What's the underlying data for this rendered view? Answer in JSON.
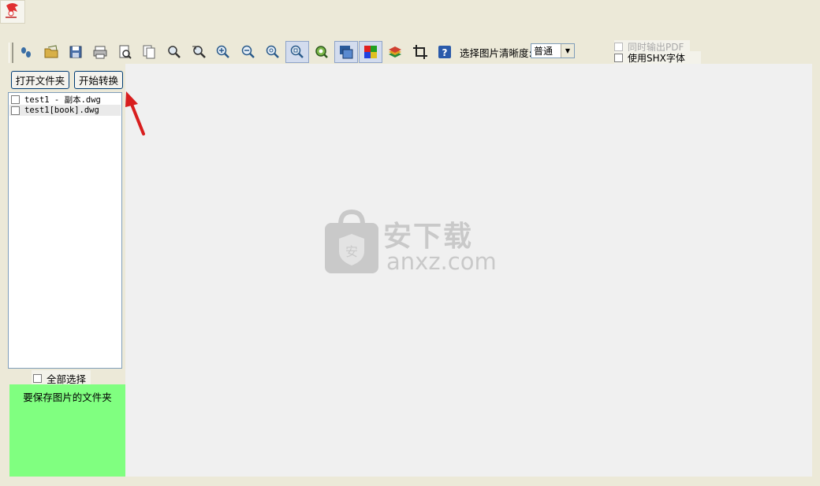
{
  "toolbar": {
    "buttons": [
      {
        "name": "footprints-icon"
      },
      {
        "name": "open-folder-icon"
      },
      {
        "name": "save-icon"
      },
      {
        "name": "print-icon"
      },
      {
        "name": "print-preview-icon"
      },
      {
        "name": "copy-pages-icon"
      },
      {
        "name": "magnifier-icon"
      },
      {
        "name": "zoom-window-icon"
      },
      {
        "name": "zoom-in-icon"
      },
      {
        "name": "zoom-out-icon"
      },
      {
        "name": "zoom-all-icon"
      },
      {
        "name": "zoom-extents-icon"
      },
      {
        "name": "zoom-previous-icon"
      },
      {
        "name": "layers-window-icon"
      },
      {
        "name": "color-palette-icon"
      },
      {
        "name": "layer-stack-icon"
      },
      {
        "name": "crop-icon"
      },
      {
        "name": "help-icon"
      }
    ],
    "clarity_label": "选择图片清晰度:",
    "clarity_value": "普通"
  },
  "options": {
    "pdf_label": "同时输出PDF",
    "shx_label": "使用SHX字体"
  },
  "buttons": {
    "open_folder": "打开文件夹",
    "start_convert": "开始转换"
  },
  "file_list": [
    {
      "name": "test1 - 副本.dwg"
    },
    {
      "name": "test1[book].dwg"
    }
  ],
  "select_all_label": "全部选择",
  "save_folder_label": "要保存图片的文件夹",
  "watermark": {
    "name": "安下载",
    "domain": "anxz.com",
    "logo_char": "安"
  },
  "colors": {
    "window_bg": "#ece9d8",
    "save_panel": "#80ff80",
    "preview_bg": "#f0f0f0",
    "annotation_arrow": "#d81e1e"
  }
}
